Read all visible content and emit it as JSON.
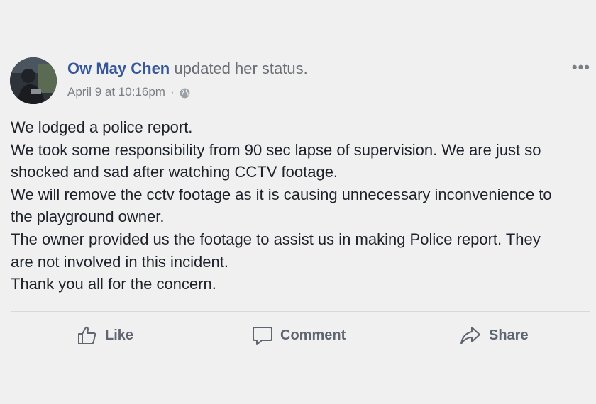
{
  "post": {
    "author": "Ow May Chen",
    "action_text": "updated her status.",
    "timestamp": "April 9 at 10:16pm",
    "separator": "·",
    "privacy_icon": "globe-icon",
    "more_label": "•••",
    "body": [
      "We lodged a police report.",
      "We took some responsibility from 90 sec lapse of supervision. We are just so",
      "shocked and sad after watching CCTV footage.",
      "We will remove the cctv footage as it is causing unnecessary inconvenience to",
      "the playground owner.",
      "The owner provided us the footage to assist us in making Police report. They",
      "are not involved in this incident.",
      "Thank you all for the concern."
    ]
  },
  "actions": {
    "like_label": "Like",
    "comment_label": "Comment",
    "share_label": "Share"
  },
  "colors": {
    "author_link": "#365899",
    "text": "#1d2129",
    "muted": "#7a7f86",
    "background": "#f0f0f0"
  }
}
